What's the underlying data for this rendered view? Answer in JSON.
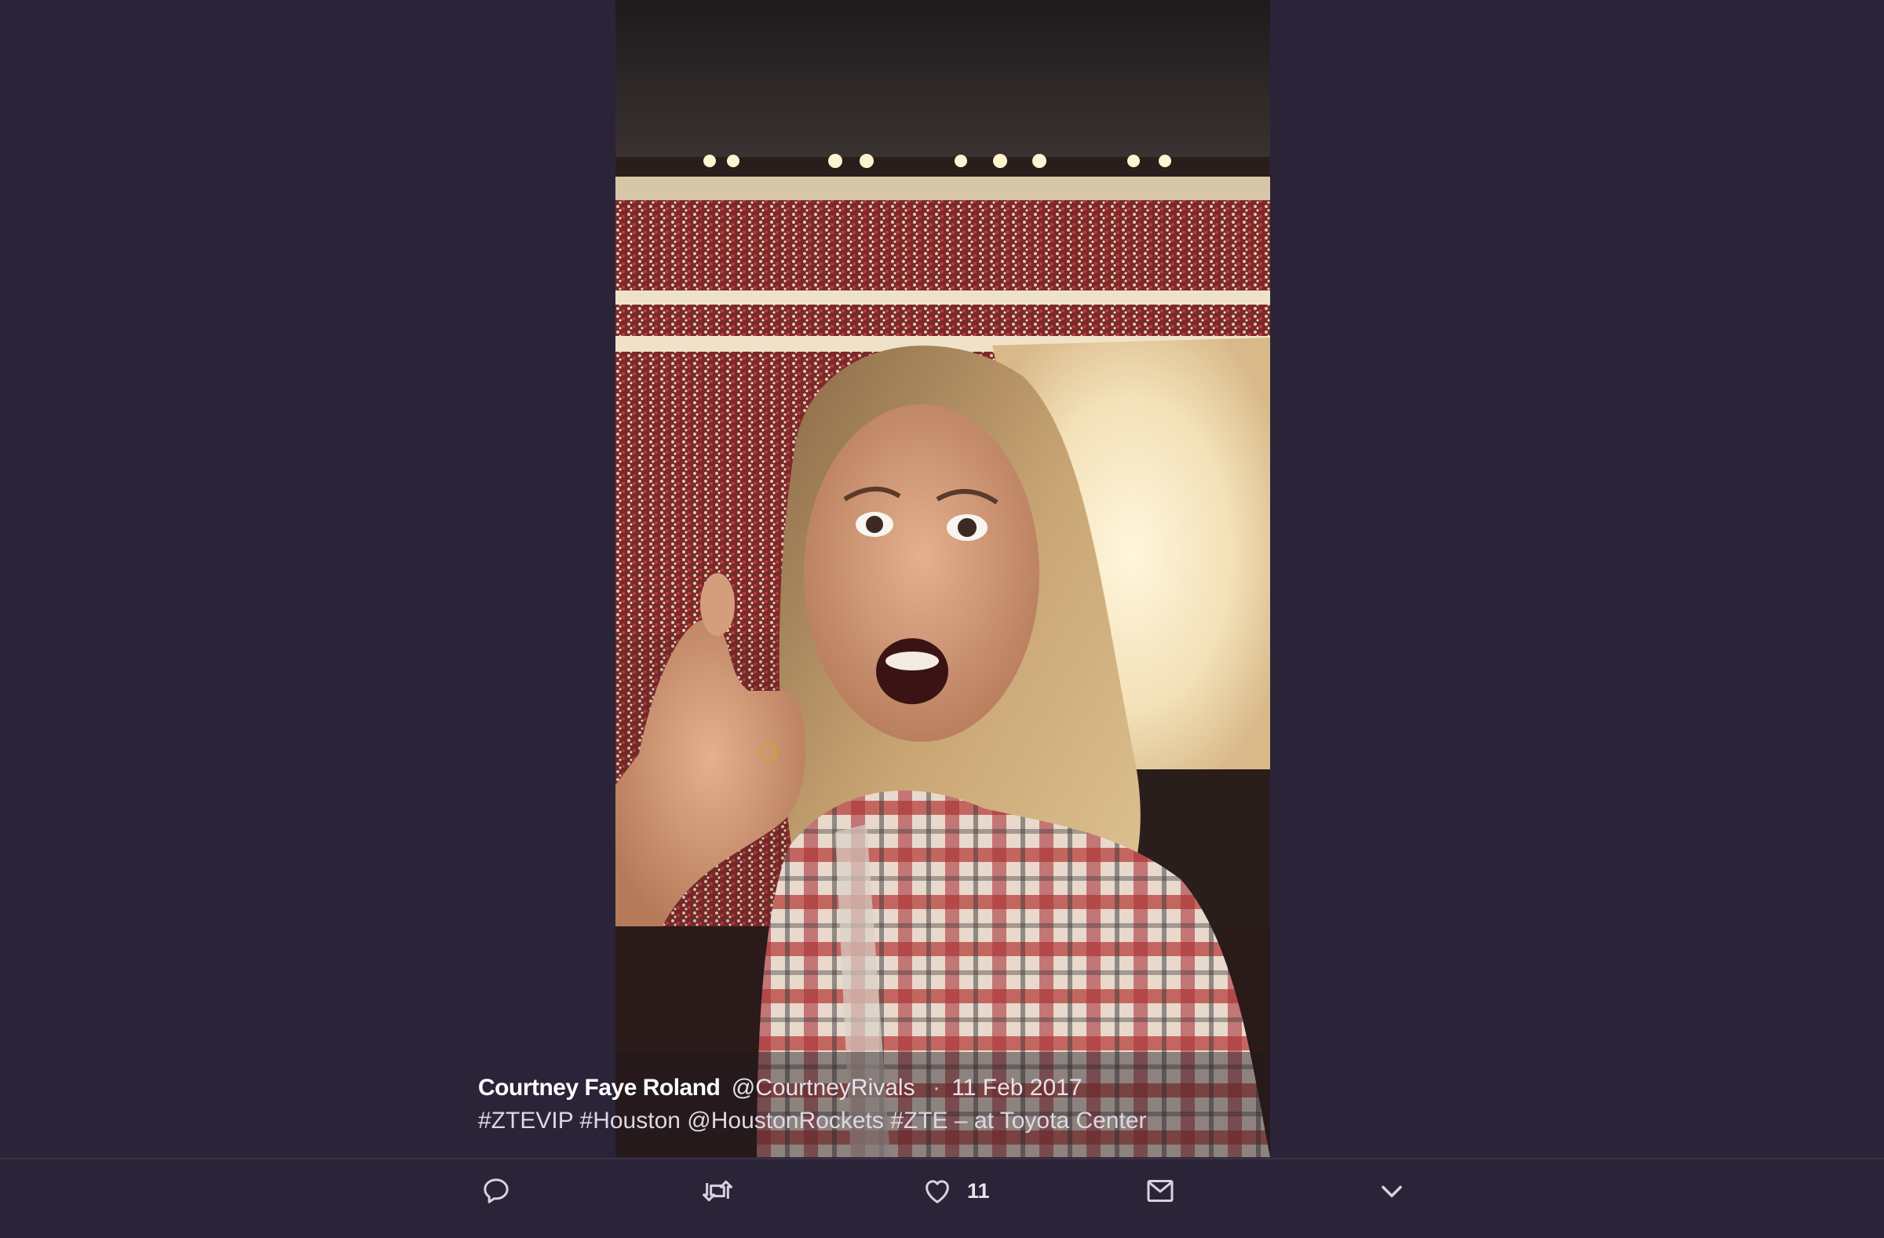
{
  "photo": {
    "subject": "selfie-at-arena"
  },
  "caption": {
    "display_name": "Courtney Faye Roland",
    "handle": "@CourtneyRivals",
    "separator": "·",
    "date": "11 Feb 2017",
    "text_parts": [
      "#ZTEVIP",
      "#Houston",
      "@HoustonRockets",
      "#ZTE",
      "– at Toyota Center"
    ]
  },
  "actions": {
    "reply": {
      "icon": "reply-icon"
    },
    "retweet": {
      "icon": "retweet-icon"
    },
    "like": {
      "icon": "heart-icon",
      "count": "11"
    },
    "message": {
      "icon": "envelope-icon"
    },
    "more": {
      "icon": "chevron-down-icon"
    }
  },
  "colors": {
    "background": "#2b2438",
    "icon": "#d7d3df"
  }
}
